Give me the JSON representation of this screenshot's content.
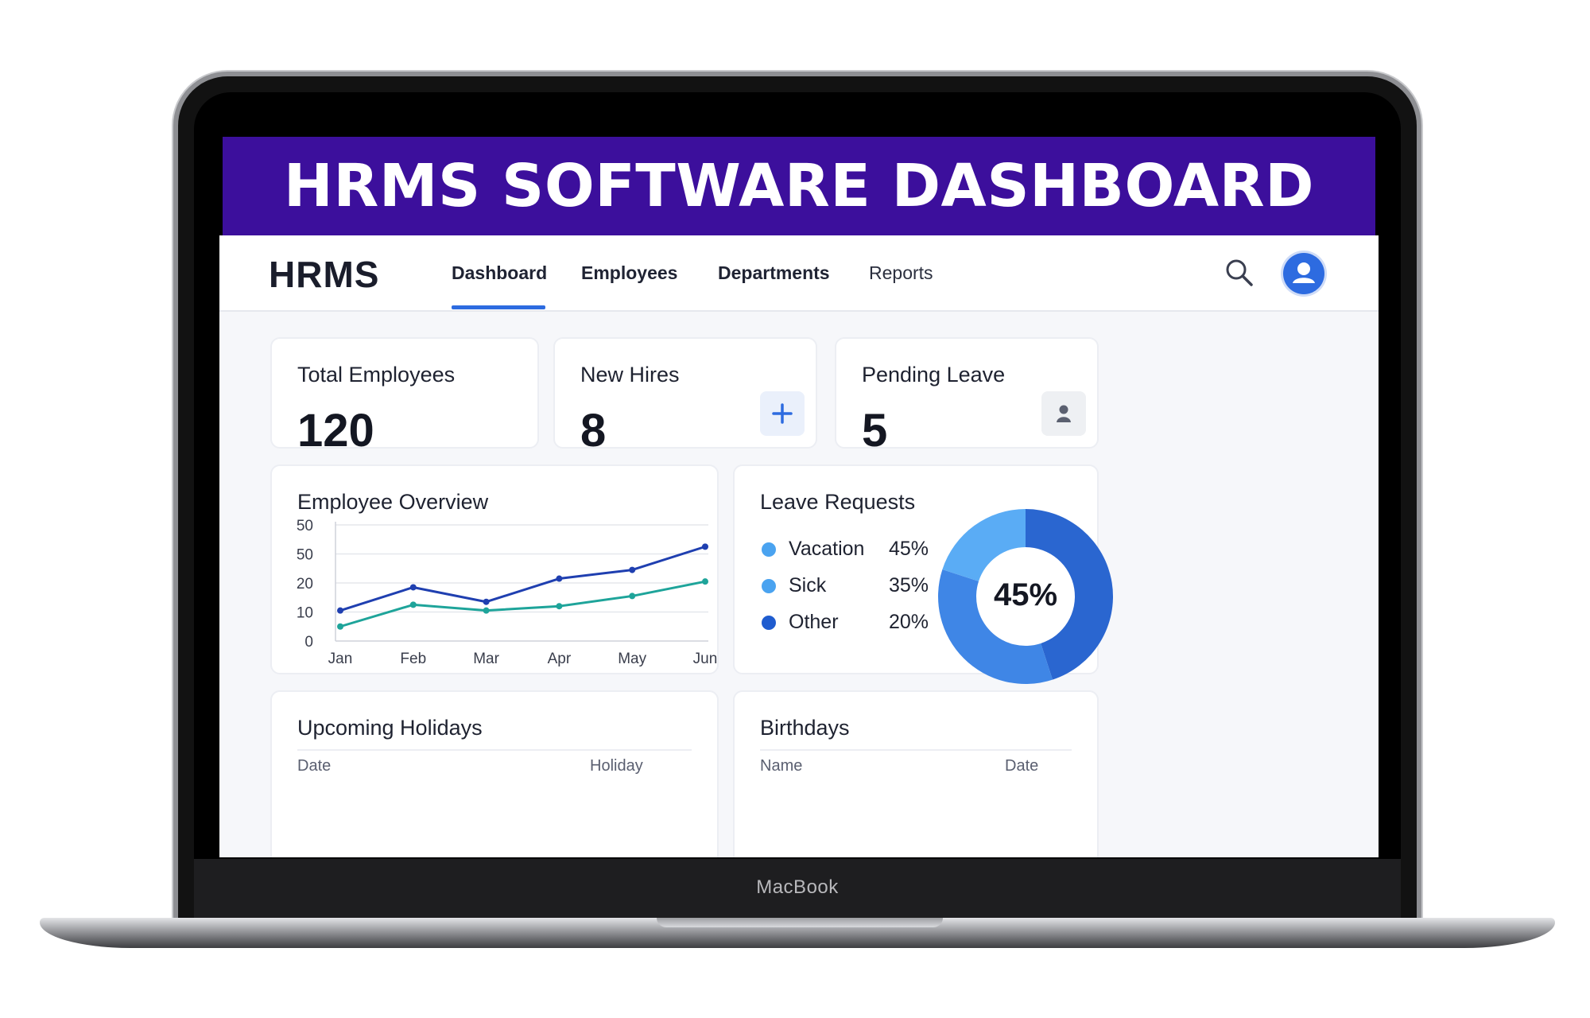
{
  "banner": {
    "title": "HRMS SOFTWARE DASHBOARD"
  },
  "laptop": {
    "brand": "MacBook"
  },
  "app": {
    "logo": "HRMS",
    "nav": [
      {
        "label": "Dashboard",
        "active": true
      },
      {
        "label": "Employees",
        "active": false
      },
      {
        "label": "Departments",
        "active": false
      },
      {
        "label": "Reports",
        "active": false
      }
    ],
    "icons": {
      "search": "search-icon",
      "account": "user-avatar-icon"
    },
    "accent": "#2d6be0"
  },
  "stats": [
    {
      "label": "Total Employees",
      "value": "120"
    },
    {
      "label": "New Hires",
      "value": "8",
      "icon": "plus-icon"
    },
    {
      "label": "Pending Leave",
      "value": "5",
      "icon": "person-icon"
    }
  ],
  "employee_overview": {
    "title": "Employee Overview"
  },
  "leave_requests": {
    "title": "Leave Requests",
    "center_label": "45%",
    "items": [
      {
        "name": "Vacation",
        "pct": "45%",
        "color": "#4aa3f0"
      },
      {
        "name": "Sick",
        "pct": "35%",
        "color": "#4aa3f0"
      },
      {
        "name": "Other",
        "pct": "20%",
        "color": "#1f5ccf"
      }
    ]
  },
  "upcoming_holidays": {
    "title": "Upcoming Holidays",
    "columns": [
      "Date",
      "Holiday"
    ]
  },
  "birthdays": {
    "title": "Birthdays",
    "columns": [
      "Name",
      "Date"
    ]
  },
  "chart_data": [
    {
      "type": "line",
      "title": "Employee Overview",
      "categories": [
        "Jan",
        "Feb",
        "Mar",
        "Apr",
        "May",
        "Jun"
      ],
      "y_tick_labels": [
        "50",
        "50",
        "20",
        "10",
        "0"
      ],
      "ylim": [
        0,
        40
      ],
      "grid": true,
      "series": [
        {
          "values": [
            10.5,
            18.5,
            13.5,
            21.5,
            24.5,
            32.5
          ],
          "color": "#1f3fb0"
        },
        {
          "values": [
            5.0,
            12.5,
            10.5,
            12.0,
            15.5,
            20.5
          ],
          "color": "#1ea49a"
        }
      ]
    },
    {
      "type": "pie",
      "title": "Leave Requests",
      "categories": [
        "Vacation",
        "Sick",
        "Other"
      ],
      "values": [
        45,
        35,
        20
      ],
      "colors": [
        "#2a66d0",
        "#3f86e6",
        "#5aacf5"
      ]
    }
  ]
}
